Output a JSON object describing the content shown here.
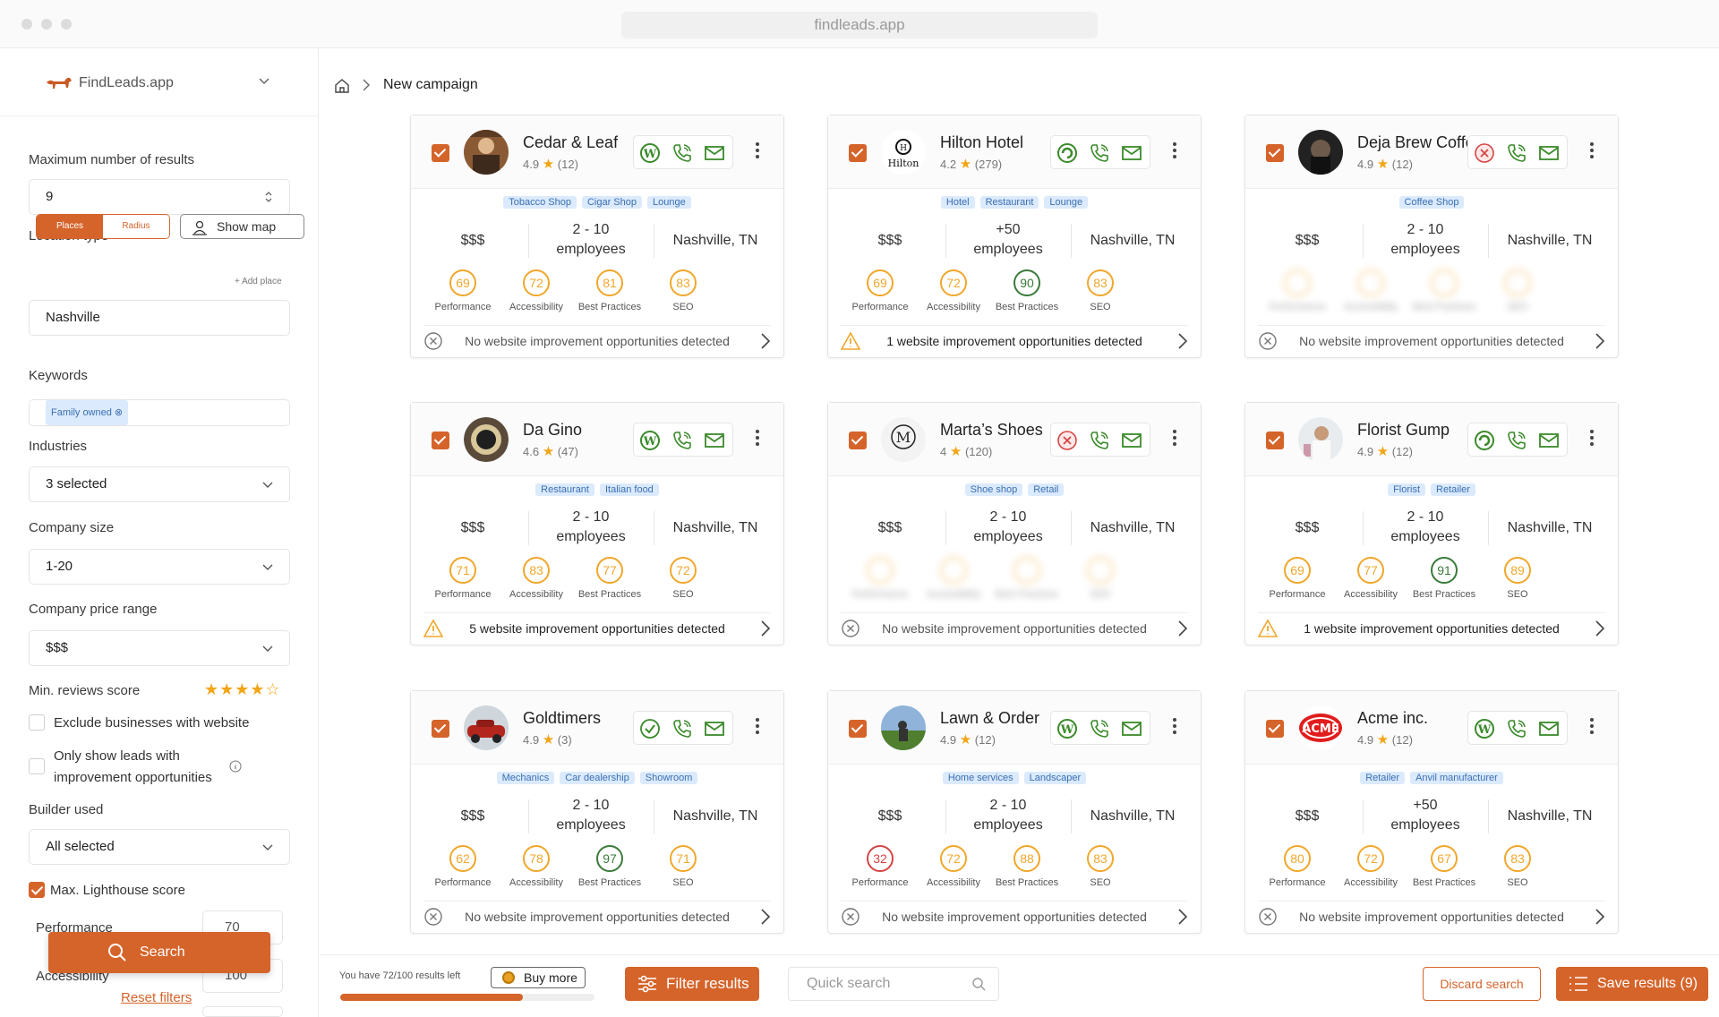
{
  "browser": {
    "url": "findleads.app"
  },
  "brand": {
    "name": "FindLeads.app"
  },
  "breadcrumb": {
    "title": "New campaign"
  },
  "sidebar": {
    "max_results_label": "Maximum number of results",
    "max_results_value": "9",
    "location_type_label": "Location type",
    "seg_places": "Places",
    "seg_radius": "Radius",
    "show_map": "Show map",
    "location_value": "Nashville",
    "add_place": "+ Add place",
    "keywords_label": "Keywords",
    "keyword_chip": "Family owned ⊗",
    "industries_label": "Industries",
    "industries_value": "3 selected",
    "company_size_label": "Company size",
    "company_size_value": "1-20",
    "price_range_label": "Company price range",
    "price_range_value": "$$$",
    "min_reviews_label": "Min. reviews score",
    "min_reviews_stars": "★★★★☆",
    "exclude_website": "Exclude businesses with website",
    "only_improve_1": "Only show leads with",
    "only_improve_2": "improvement opportunities",
    "builder_label": "Builder used",
    "builder_value": "All selected",
    "max_lighthouse": "Max. Lighthouse score",
    "perf_label": "Performance",
    "perf_value": "70",
    "acc_label": "Accessibility",
    "acc_value": "100",
    "search_btn": "Search",
    "reset_filters": "Reset filters"
  },
  "score_labels": [
    "Performance",
    "Accessibility",
    "Best Practices",
    "SEO"
  ],
  "cards": [
    {
      "name": "Cedar & Leaf",
      "rating": "4.9",
      "reviews": "(12)",
      "tags": [
        "Tobacco Shop",
        "Cigar Shop",
        "Lounge"
      ],
      "price": "$$$",
      "emp1": "2 - 10",
      "emp2": "employees",
      "location": "Nashville, TN",
      "scores": [
        "69",
        "72",
        "81",
        "83"
      ],
      "footer": "No website improvement opportunities detected"
    },
    {
      "name": "Hilton Hotel",
      "rating": "4.2",
      "reviews": "(279)",
      "tags": [
        "Hotel",
        "Restaurant",
        "Lounge"
      ],
      "price": "$$$",
      "emp1": "+50",
      "emp2": "employees",
      "location": "Nashville, TN",
      "scores": [
        "69",
        "72",
        "90",
        "83"
      ],
      "footer": "1 website improvement opportunities detected"
    },
    {
      "name": "Deja Brew Coffee",
      "rating": "4.9",
      "reviews": "(12)",
      "tags": [
        "Coffee Shop"
      ],
      "price": "$$$",
      "emp1": "2 - 10",
      "emp2": "employees",
      "location": "Nashville, TN",
      "scores": [
        "",
        "",
        "",
        ""
      ],
      "footer": "No website improvement opportunities detected"
    },
    {
      "name": "Da Gino",
      "rating": "4.6",
      "reviews": "(47)",
      "tags": [
        "Restaurant",
        "Italian food"
      ],
      "price": "$$$",
      "emp1": "2 - 10",
      "emp2": "employees",
      "location": "Nashville, TN",
      "scores": [
        "71",
        "83",
        "77",
        "72"
      ],
      "footer": "5 website improvement opportunities detected"
    },
    {
      "name": "Marta’s Shoes",
      "rating": "4",
      "reviews": "(120)",
      "tags": [
        "Shoe shop",
        "Retail"
      ],
      "price": "$$$",
      "emp1": "2 - 10",
      "emp2": "employees",
      "location": "Nashville, TN",
      "scores": [
        "",
        "",
        "",
        ""
      ],
      "footer": "No website improvement opportunities detected"
    },
    {
      "name": "Florist Gump",
      "rating": "4.9",
      "reviews": "(12)",
      "tags": [
        "Florist",
        "Retailer"
      ],
      "price": "$$$",
      "emp1": "2 - 10",
      "emp2": "employees",
      "location": "Nashville, TN",
      "scores": [
        "69",
        "77",
        "91",
        "89"
      ],
      "footer": "1 website improvement opportunities detected"
    },
    {
      "name": "Goldtimers",
      "rating": "4.9",
      "reviews": "(3)",
      "tags": [
        "Mechanics",
        "Car dealership",
        "Showroom"
      ],
      "price": "$$$",
      "emp1": "2 - 10",
      "emp2": "employees",
      "location": "Nashville, TN",
      "scores": [
        "62",
        "78",
        "97",
        "71"
      ],
      "footer": "No website improvement opportunities detected"
    },
    {
      "name": "Lawn & Order",
      "rating": "4.9",
      "reviews": "(12)",
      "tags": [
        "Home services",
        "Landscaper"
      ],
      "price": "$$$",
      "emp1": "2 - 10",
      "emp2": "employees",
      "location": "Nashville, TN",
      "scores": [
        "32",
        "72",
        "88",
        "83"
      ],
      "footer": "No website improvement opportunities detected"
    },
    {
      "name": "Acme inc.",
      "rating": "4.9",
      "reviews": "(12)",
      "tags": [
        "Retailer",
        "Anvil manufacturer"
      ],
      "price": "$$$",
      "emp1": "+50",
      "emp2": "employees",
      "location": "Nashville, TN",
      "scores": [
        "80",
        "72",
        "67",
        "83"
      ],
      "footer": "No website improvement opportunities detected"
    }
  ],
  "card_logo_text": {
    "hilton": "Hilton",
    "acme": "ACME",
    "marta": "M"
  },
  "bottom": {
    "results_left": "You have 72/100 results left",
    "results_used_fraction": 0.72,
    "buy_more": "Buy more",
    "filter_results": "Filter results",
    "quick_search_placeholder": "Quick search",
    "discard": "Discard search",
    "save": "Save results (9)"
  },
  "colors": {
    "accent": "#d5642b",
    "score_orange": "#f0a72b",
    "score_green": "#3a7b3a",
    "score_red": "#d64545",
    "tag_bg": "#dbeafd"
  }
}
